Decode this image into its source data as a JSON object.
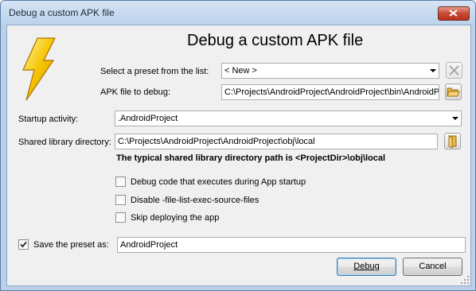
{
  "window": {
    "title": "Debug a custom APK file",
    "close_icon": "close-icon"
  },
  "heading": "Debug a custom APK file",
  "preset": {
    "label": "Select a preset from the list:",
    "value": "< New >"
  },
  "apk": {
    "label": "APK file to debug:",
    "value": "C:\\Projects\\AndroidProject\\AndroidProject\\bin\\AndroidP"
  },
  "startup": {
    "label": "Startup activity:",
    "value": ".AndroidProject"
  },
  "shared_lib": {
    "label": "Shared library directory:",
    "value": "C:\\Projects\\AndroidProject\\AndroidProject\\obj\\local",
    "note": "The typical shared library directory path is <ProjectDir>\\obj\\local"
  },
  "options": [
    {
      "label": "Debug code that executes during App startup",
      "checked": false
    },
    {
      "label": "Disable -file-list-exec-source-files",
      "checked": false
    },
    {
      "label": "Skip deploying the app",
      "checked": false
    }
  ],
  "save_preset": {
    "label": "Save the preset as:",
    "checked": true,
    "value": "AndroidProject"
  },
  "buttons": {
    "debug": "Debug",
    "cancel": "Cancel"
  },
  "colors": {
    "title_bar": "#bcd2ec",
    "close_button": "#c74a35",
    "lightning": "#f5c400",
    "folder": "#e8b84a"
  }
}
